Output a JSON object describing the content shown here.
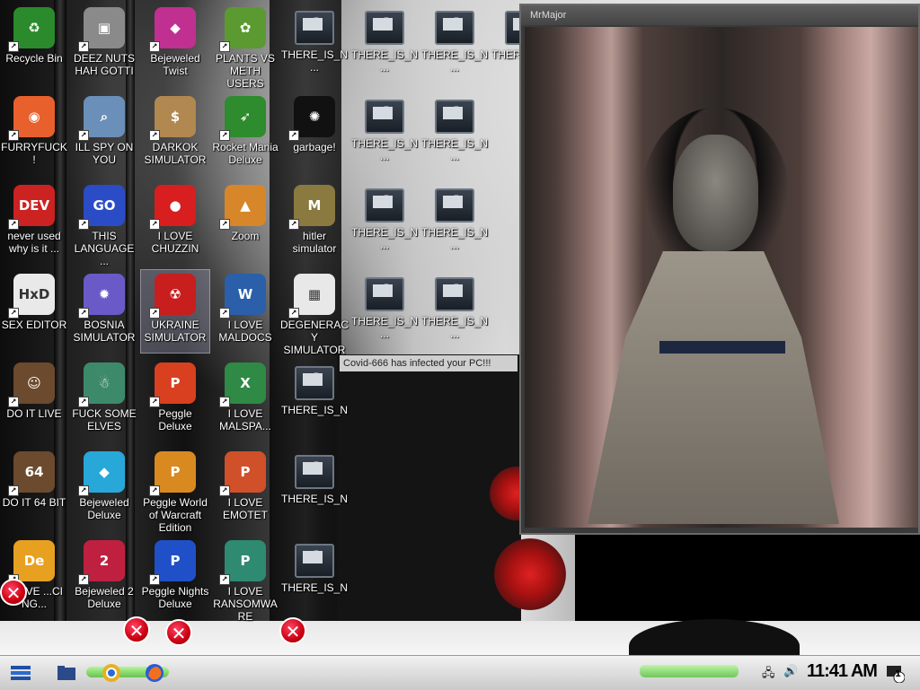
{
  "desktop": {
    "icons": [
      {
        "label": "Recycle Bin",
        "glyph": "♻",
        "color": "#2b8a2b"
      },
      {
        "label": "DEEZ NUTS HAH GOTTI",
        "glyph": "▣",
        "color": "#8a8a8a"
      },
      {
        "label": "Bejeweled Twist",
        "glyph": "◆",
        "color": "#c03090"
      },
      {
        "label": "PLANTS VS METH USERS",
        "glyph": "✿",
        "color": "#5a9a30"
      },
      {
        "label": "THERE_IS_N...",
        "glyph": "",
        "color": "#333"
      },
      {
        "label": "THERE_IS_N...",
        "glyph": "",
        "color": "#333"
      },
      {
        "label": "THERE_IS_N...",
        "glyph": "",
        "color": "#333"
      },
      {
        "label": "THERE_IS_N...",
        "glyph": "",
        "color": "#333"
      },
      {
        "label": "FURRYFUCK!",
        "glyph": "◉",
        "color": "#e8602c"
      },
      {
        "label": "ILL SPY ON YOU",
        "glyph": "⌕",
        "color": "#6a8fb8"
      },
      {
        "label": "DARKOK SIMULATOR",
        "glyph": "$",
        "color": "#b08850"
      },
      {
        "label": "Rocket Mania Deluxe",
        "glyph": "➶",
        "color": "#2e8b2e"
      },
      {
        "label": "garbage!",
        "glyph": "✺",
        "color": "#111"
      },
      {
        "label": "THERE_IS_N...",
        "glyph": "",
        "color": "#333"
      },
      {
        "label": "THERE_IS_N...",
        "glyph": "",
        "color": "#333"
      },
      {
        "label": "never used why is it ...",
        "glyph": "DEV",
        "color": "#cc2222"
      },
      {
        "label": "THIS LANGUAGE ...",
        "glyph": "GO",
        "color": "#2b4cc7"
      },
      {
        "label": "I LOVE CHUZZIN",
        "glyph": "●",
        "color": "#d81e1e"
      },
      {
        "label": "Zoom",
        "glyph": "▲",
        "color": "#d8862a"
      },
      {
        "label": "hitler simulator",
        "glyph": "M",
        "color": "#8a7a40"
      },
      {
        "label": "THERE_IS_N...",
        "glyph": "",
        "color": "#333"
      },
      {
        "label": "THERE_IS_N...",
        "glyph": "",
        "color": "#333"
      },
      {
        "label": "SEX EDITOR",
        "glyph": "HxD",
        "color": "#e9e9e9"
      },
      {
        "label": "BOSNIA SIMULATOR",
        "glyph": "✹",
        "color": "#6a5ac8"
      },
      {
        "label": "UKRAINE SIMULATOR",
        "glyph": "☢",
        "color": "#c81e1e"
      },
      {
        "label": "I LOVE MALDOCS",
        "glyph": "W",
        "color": "#2b5faa"
      },
      {
        "label": "DEGENERACY SIMULATOR",
        "glyph": "▦",
        "color": "#e8e8e8"
      },
      {
        "label": "THERE_IS_N...",
        "glyph": "",
        "color": "#333"
      },
      {
        "label": "THERE_IS_N...",
        "glyph": "",
        "color": "#333"
      },
      {
        "label": "DO IT LIVE",
        "glyph": "☺",
        "color": "#6b4a2e"
      },
      {
        "label": "FUCK SOME ELVES",
        "glyph": "☃",
        "color": "#3d8a6a"
      },
      {
        "label": "Peggle Deluxe",
        "glyph": "P",
        "color": "#d84020"
      },
      {
        "label": "I LOVE MALSPA...",
        "glyph": "X",
        "color": "#2e8a45"
      },
      {
        "label": "THERE_IS_N",
        "glyph": "",
        "color": "#333"
      },
      {
        "label": "DO IT 64 BIT",
        "glyph": "64",
        "color": "#6b4a2e"
      },
      {
        "label": "Bejeweled Deluxe",
        "glyph": "◆",
        "color": "#28a8d8"
      },
      {
        "label": "Peggle World of Warcraft Edition",
        "glyph": "P",
        "color": "#d88a20"
      },
      {
        "label": "I LOVE EMOTET",
        "glyph": "P",
        "color": "#d0502a"
      },
      {
        "label": "THERE_IS_N",
        "glyph": "",
        "color": "#333"
      },
      {
        "label": "I LOVE ...CI NG...",
        "glyph": "De",
        "color": "#e8a020"
      },
      {
        "label": "Bejeweled 2 Deluxe",
        "glyph": "2",
        "color": "#c02040"
      },
      {
        "label": "Peggle Nights Deluxe",
        "glyph": "P",
        "color": "#2050c8"
      },
      {
        "label": "I LOVE RANSOMWARE",
        "glyph": "P",
        "color": "#2e8a70"
      },
      {
        "label": "THERE_IS_N",
        "glyph": "",
        "color": "#333"
      }
    ]
  },
  "overlay_window": {
    "title": "MrMajor"
  },
  "covid_popup": {
    "title": "Covid-666 has infected your PC!!!"
  },
  "taskbar": {
    "clock": "11:41 AM",
    "notification_count": "1"
  }
}
